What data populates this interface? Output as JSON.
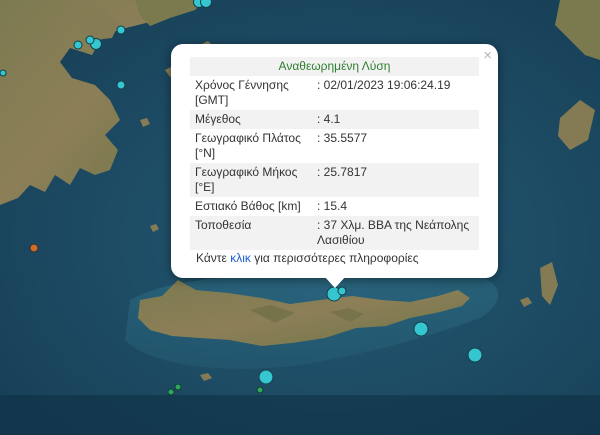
{
  "popup": {
    "close_symbol": "×",
    "title": "Αναθεωρημένη Λύση",
    "rows": [
      {
        "label": "Χρόνος Γέννησης [GMT]",
        "value": ": 02/01/2023 19:06:24.19"
      },
      {
        "label": "Μέγεθος",
        "value": ": 4.1"
      },
      {
        "label": "Γεωγραφικό Πλάτος [°N]",
        "value": ": 35.5577"
      },
      {
        "label": "Γεωγραφικό Μήκος [°E]",
        "value": ": 25.7817"
      },
      {
        "label": "Εστιακό Βάθος [km]",
        "value": ": 15.4"
      },
      {
        "label": "Τοποθεσία",
        "value": ": 37 Χλμ. ΒΒΑ της Νεάπολης Λασιθίου"
      }
    ],
    "more_prefix": "Κάντε ",
    "more_link": "κλικ",
    "more_suffix": " για περισσότερες πληροφορίες"
  },
  "colors": {
    "sea": "#1c4a62",
    "land": "#8a7f57",
    "quake_cyan": "#35c6cf",
    "quake_green": "#2fa85a",
    "quake_orange": "#d06a2a",
    "title_green": "#2e7d2e",
    "link_blue": "#1a5fd0"
  },
  "map": {
    "style": "satellite",
    "icons": [
      "earthquake-marker-icon",
      "close-icon",
      "popup-pointer-icon"
    ]
  }
}
